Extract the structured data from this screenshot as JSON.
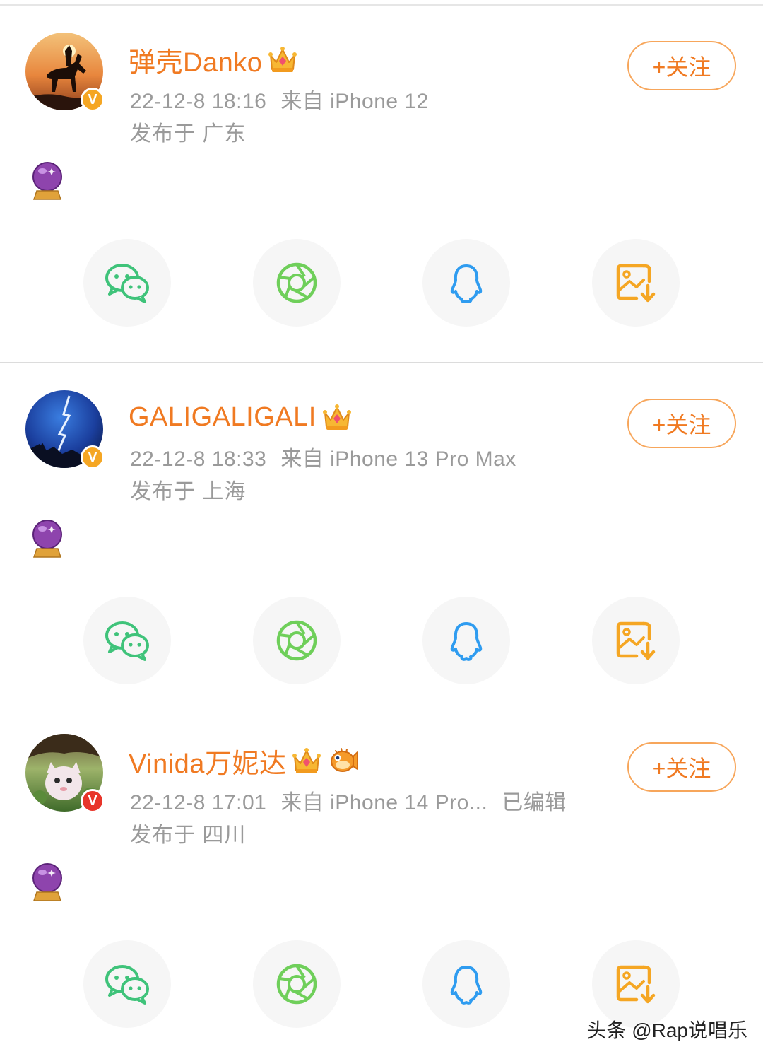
{
  "posts": [
    {
      "user_name": "弹壳Danko",
      "time": "22-12-8 18:16",
      "source": "来自 iPhone 12",
      "edited": "",
      "location": "发布于 广东",
      "verify_badge": "V",
      "verify_color": "#f5a623",
      "badges": [
        "crown-icon"
      ],
      "follow_label": "+关注",
      "content_emoji": "crystal-ball-icon",
      "share": [
        "wechat-icon",
        "moments-icon",
        "qq-icon",
        "save-image-icon"
      ]
    },
    {
      "user_name": "GALIGALIGALI",
      "time": "22-12-8 18:33",
      "source": "来自 iPhone 13 Pro Max",
      "edited": "",
      "location": "发布于 上海",
      "verify_badge": "V",
      "verify_color": "#f5a623",
      "badges": [
        "crown-icon"
      ],
      "follow_label": "+关注",
      "content_emoji": "crystal-ball-icon",
      "share": [
        "wechat-icon",
        "moments-icon",
        "qq-icon",
        "save-image-icon"
      ]
    },
    {
      "user_name": "Vinida万妮达",
      "time": "22-12-8 17:01",
      "source": "来自 iPhone 14 Pro...",
      "edited": "已编辑",
      "location": "发布于 四川",
      "verify_badge": "V",
      "verify_color": "#e8352a",
      "badges": [
        "crown-icon",
        "pufferfish-icon"
      ],
      "follow_label": "+关注",
      "content_emoji": "crystal-ball-icon",
      "share": [
        "wechat-icon",
        "moments-icon",
        "qq-icon",
        "save-image-icon"
      ]
    }
  ],
  "colors": {
    "name_orange": "#f07a22",
    "meta_gray": "#9a9a9a",
    "wechat_green": "#3fc37a",
    "moments_green": "#6fcf5a",
    "qq_blue": "#2f9cf0",
    "save_orange": "#f5a623"
  },
  "watermark": "头条 @Rap说唱乐"
}
